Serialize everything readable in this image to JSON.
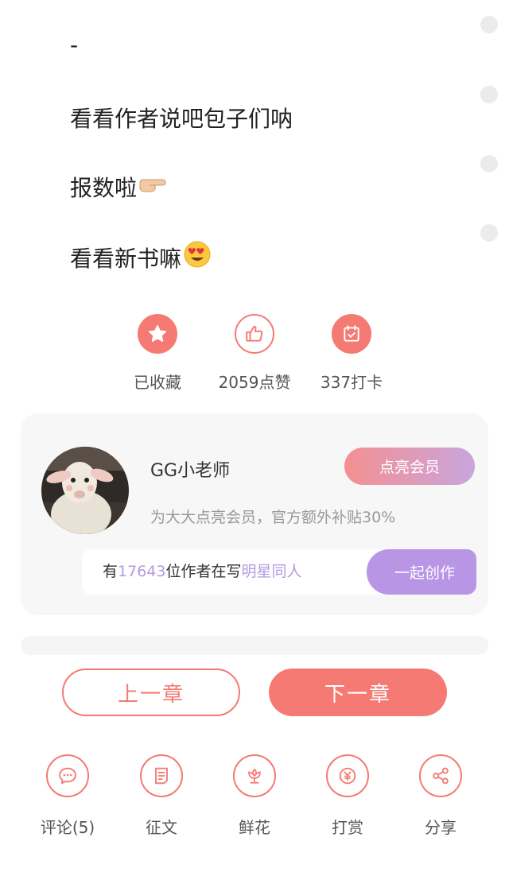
{
  "content": {
    "lines": [
      {
        "text": "-",
        "emoji": ""
      },
      {
        "text": "看看作者说吧包子们呐",
        "emoji": ""
      },
      {
        "text": "报数啦",
        "emoji": "pointing-finger-emoji"
      },
      {
        "text": "看看新书嘛",
        "emoji": "heart-eyes-emoji"
      }
    ]
  },
  "actions": {
    "collect_label": "已收藏",
    "like_label": "2059点赞",
    "checkin_label": "337打卡",
    "collect_icon": "star-icon",
    "like_icon": "thumbs-up-icon",
    "checkin_icon": "calendar-check-icon"
  },
  "author": {
    "name": "GG小老师",
    "member_button": "点亮会员",
    "member_desc": "为大大点亮会员，官方额外补贴30%",
    "create_prefix": "有",
    "author_count": "17643",
    "create_middle": "位作者在写",
    "topic": "明星同人",
    "create_button": "一起创作"
  },
  "chapter_nav": {
    "prev_label": "上一章",
    "next_label": "下一章"
  },
  "bottom_bar": {
    "items": [
      {
        "label": "评论(5)",
        "icon": "comment-icon"
      },
      {
        "label": "征文",
        "icon": "essay-icon"
      },
      {
        "label": "鲜花",
        "icon": "flower-icon"
      },
      {
        "label": "打赏",
        "icon": "reward-icon"
      },
      {
        "label": "分享",
        "icon": "share-icon"
      }
    ]
  },
  "colors": {
    "accent": "#f47a73",
    "purple": "#b995e6",
    "card_bg": "#f7f7f7"
  }
}
